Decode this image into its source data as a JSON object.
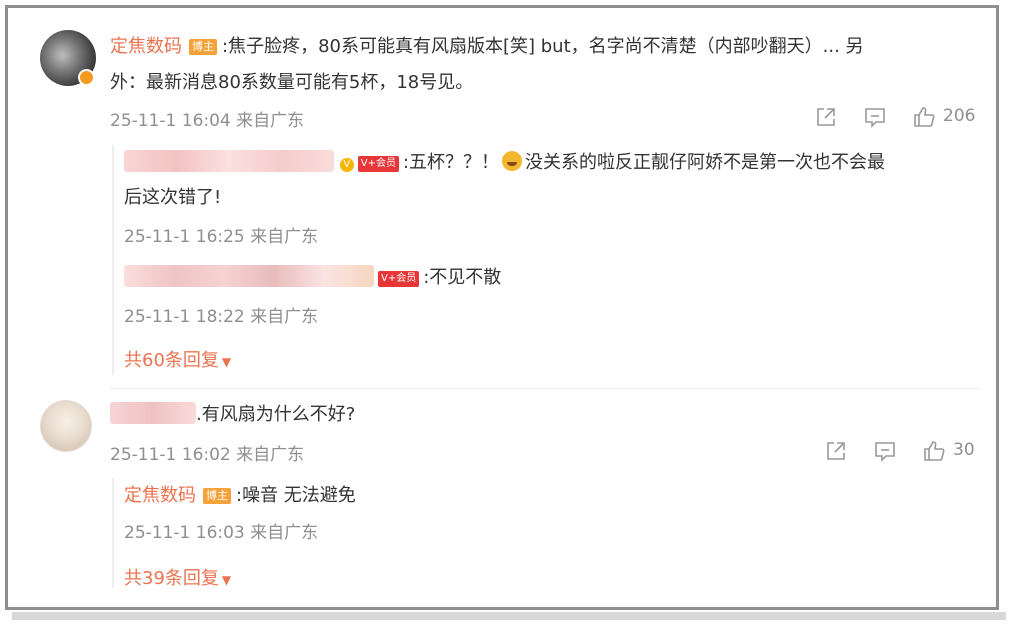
{
  "comments": [
    {
      "author": "定焦数码",
      "badge": "博主",
      "text_line1": ":焦子脸疼，80系可能真有风扇版本[笑] but，名字尚不清楚（内部吵翻天）... 另",
      "text_line2": "外：最新消息80系数量可能有5杯，18号见。",
      "time": "25-11-1 16:04 来自广东",
      "like_count": "206",
      "replies": [
        {
          "vip_badge": "V+会员",
          "text_line1": ":五杯？？！",
          "text_line1b": "没关系的啦反正靓仔阿娇不是第一次也不会最",
          "text_line2": "后这次错了!",
          "time": "25-11-1 16:25 来自广东"
        },
        {
          "vip_badge": "V+会员",
          "text": ":不见不散",
          "time": "25-11-1 18:22 来自广东"
        }
      ],
      "more_replies": "共60条回复"
    },
    {
      "text": ".有风扇为什么不好?",
      "time": "25-11-1 16:02 来自广东",
      "like_count": "30",
      "replies": [
        {
          "author": "定焦数码",
          "badge": "博主",
          "text": ":噪音 无法避免",
          "time": "25-11-1 16:03 来自广东"
        }
      ],
      "more_replies": "共39条回复"
    }
  ],
  "colors": {
    "accent": "#eb7350",
    "meta": "#8f8f8f",
    "text": "#333333"
  }
}
